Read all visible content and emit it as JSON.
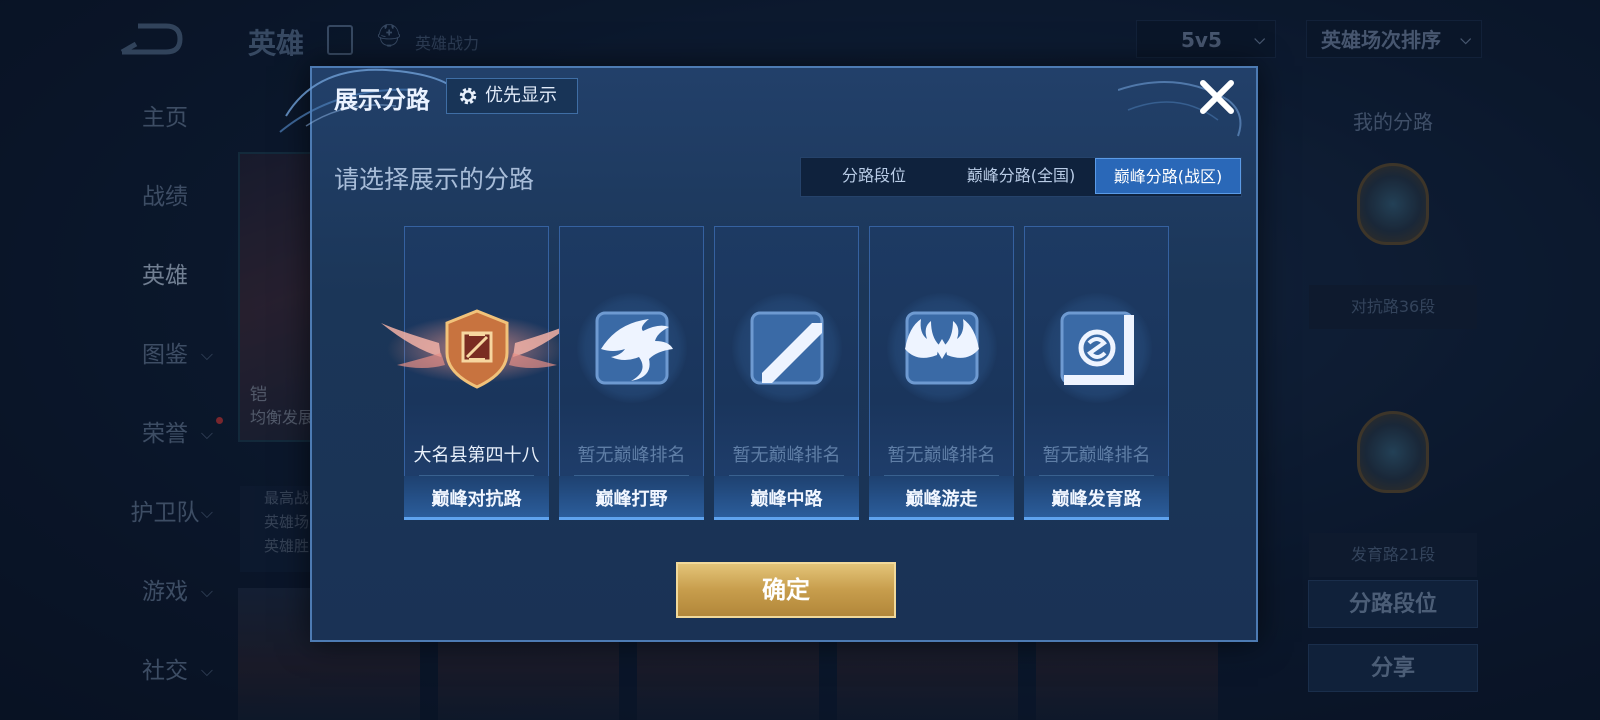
{
  "background": {
    "nav": [
      {
        "label": "主页",
        "chevron": false,
        "active": false
      },
      {
        "label": "战绩",
        "chevron": false,
        "active": false
      },
      {
        "label": "英雄",
        "chevron": false,
        "active": true
      },
      {
        "label": "图鉴",
        "chevron": true,
        "active": false
      },
      {
        "label": "荣誉",
        "chevron": true,
        "active": false,
        "dot": true
      },
      {
        "label": "护卫队",
        "chevron": true,
        "active": false
      },
      {
        "label": "游戏",
        "chevron": true,
        "active": false
      },
      {
        "label": "社交",
        "chevron": true,
        "active": false
      }
    ],
    "header": {
      "title": "英雄",
      "power_label": "英雄战力",
      "mode_select": "5v5",
      "sort_select": "英雄场次排序"
    },
    "hero": {
      "name": "铠",
      "desc": "均衡发展",
      "stats": [
        "最高战",
        "英雄场",
        "英雄胜"
      ]
    },
    "right_panel": {
      "title": "我的分路",
      "lane1": "对抗路36段",
      "lane2": "发育路21段",
      "btn_lane_rank": "分路段位",
      "btn_share": "分享"
    }
  },
  "modal": {
    "title": "展示分路",
    "priority_button": "优先显示",
    "subtitle": "请选择展示的分路",
    "tabs": [
      {
        "label": "分路段位",
        "active": false
      },
      {
        "label": "巅峰分路(全国)",
        "active": false
      },
      {
        "label": "巅峰分路(战区)",
        "active": true
      }
    ],
    "lanes": [
      {
        "name": "巅峰对抗路",
        "rank": "大名县第四十八",
        "icon": "clash-lane-badge-icon",
        "ranked": true
      },
      {
        "name": "巅峰打野",
        "rank": "暂无巅峰排名",
        "icon": "jungle-dragon-icon",
        "ranked": false
      },
      {
        "name": "巅峰中路",
        "rank": "暂无巅峰排名",
        "icon": "mid-lane-icon",
        "ranked": false
      },
      {
        "name": "巅峰游走",
        "rank": "暂无巅峰排名",
        "icon": "roam-wings-icon",
        "ranked": false
      },
      {
        "name": "巅峰发育路",
        "rank": "暂无巅峰排名",
        "icon": "farm-lane-icon",
        "ranked": false
      }
    ],
    "confirm_button": "确定"
  },
  "colors": {
    "modal_bg": "#1b3658",
    "active_tab": "#2a68b8",
    "confirm_gold": "#c79d4c"
  }
}
